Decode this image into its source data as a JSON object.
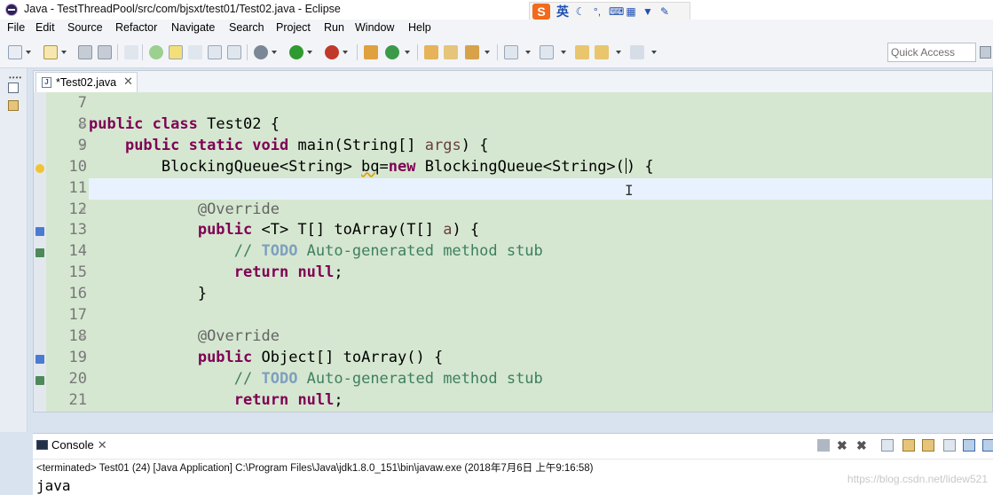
{
  "window": {
    "title": "Java - TestThreadPool/src/com/bjsxt/test01/Test02.java - Eclipse"
  },
  "ime": {
    "logo": "S",
    "lang": "英"
  },
  "menu": [
    "File",
    "Edit",
    "Source",
    "Refactor",
    "Navigate",
    "Search",
    "Project",
    "Run",
    "Window",
    "Help"
  ],
  "quick_access": {
    "placeholder": "Quick Access"
  },
  "editor": {
    "tab_label": "*Test02.java",
    "lines": [
      {
        "n": "7",
        "code": []
      },
      {
        "n": "8",
        "code": [
          {
            "k": "kw",
            "t": "public"
          },
          {
            "t": " "
          },
          {
            "k": "kw",
            "t": "class"
          },
          {
            "t": " Test02 {"
          }
        ]
      },
      {
        "n": "9",
        "code": [
          {
            "t": "    "
          },
          {
            "k": "kw",
            "t": "public"
          },
          {
            "t": " "
          },
          {
            "k": "kw",
            "t": "static"
          },
          {
            "t": " "
          },
          {
            "k": "kw",
            "t": "void"
          },
          {
            "t": " main(String[] "
          },
          {
            "k": "arg",
            "t": "args"
          },
          {
            "t": ") {"
          }
        ]
      },
      {
        "n": "10",
        "code": [
          {
            "t": "        BlockingQueue<String> "
          },
          {
            "k": "warn",
            "t": "bq"
          },
          {
            "t": "="
          },
          {
            "k": "kw",
            "t": "new"
          },
          {
            "t": " BlockingQueue<String>("
          },
          {
            "k": "caret",
            "t": ""
          },
          {
            "t": ") {"
          }
        ]
      },
      {
        "n": "11",
        "code": []
      },
      {
        "n": "12",
        "code": [
          {
            "t": "            "
          },
          {
            "k": "ann",
            "t": "@Override"
          }
        ]
      },
      {
        "n": "13",
        "code": [
          {
            "t": "            "
          },
          {
            "k": "kw",
            "t": "public"
          },
          {
            "t": " <T> T[] toArray(T[] "
          },
          {
            "k": "arg",
            "t": "a"
          },
          {
            "t": ") {"
          }
        ]
      },
      {
        "n": "14",
        "code": [
          {
            "t": "                "
          },
          {
            "k": "cm",
            "t": "// "
          },
          {
            "k": "todo",
            "t": "TODO"
          },
          {
            "k": "cm",
            "t": " Auto-generated method stub"
          }
        ]
      },
      {
        "n": "15",
        "code": [
          {
            "t": "                "
          },
          {
            "k": "kw",
            "t": "return"
          },
          {
            "t": " "
          },
          {
            "k": "kw",
            "t": "null"
          },
          {
            "t": ";"
          }
        ]
      },
      {
        "n": "16",
        "code": [
          {
            "t": "            }"
          }
        ]
      },
      {
        "n": "17",
        "code": []
      },
      {
        "n": "18",
        "code": [
          {
            "t": "            "
          },
          {
            "k": "ann",
            "t": "@Override"
          }
        ]
      },
      {
        "n": "19",
        "code": [
          {
            "t": "            "
          },
          {
            "k": "kw",
            "t": "public"
          },
          {
            "t": " Object[] toArray() {"
          }
        ]
      },
      {
        "n": "20",
        "code": [
          {
            "t": "                "
          },
          {
            "k": "cm",
            "t": "// "
          },
          {
            "k": "todo",
            "t": "TODO"
          },
          {
            "k": "cm",
            "t": " Auto-generated method stub"
          }
        ]
      },
      {
        "n": "21",
        "code": [
          {
            "t": "                "
          },
          {
            "k": "kw",
            "t": "return"
          },
          {
            "t": " "
          },
          {
            "k": "kw",
            "t": "null"
          },
          {
            "t": ";"
          }
        ]
      }
    ]
  },
  "console": {
    "tab_label": "Console",
    "status": "<terminated> Test01 (24) [Java Application] C:\\Program Files\\Java\\jdk1.8.0_151\\bin\\javaw.exe (2018年7月6日 上午9:16:58)",
    "output": "java"
  },
  "watermark": "https://blog.csdn.net/lidew521",
  "colors": {
    "keyword": "#7f0055",
    "comment": "#3f7f5f",
    "todo": "#7f9fbf",
    "annotation": "#646464",
    "editor_bg": "#d5e7d0",
    "current_line": "#e8f2fe"
  }
}
